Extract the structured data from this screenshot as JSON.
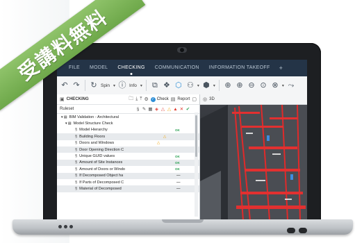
{
  "watermark": {
    "text": "受講料無料",
    "color": "#7cb557"
  },
  "menu": {
    "items": [
      "FILE",
      "MODEL",
      "CHECKING",
      "COMMUNICATION",
      "INFORMATION TAKEOFF"
    ],
    "active": "CHECKING",
    "plus": "+"
  },
  "toolbar": {
    "spin_label": "Spin",
    "info_label": "Info"
  },
  "checking_panel": {
    "title": "CHECKING",
    "check_label": "Check",
    "report_label": "Report",
    "column_label": "Ruleset",
    "rows": [
      {
        "label": "BIM Validation - Architectural",
        "status": "",
        "level": 0
      },
      {
        "label": "Model Structure Check",
        "status": "",
        "level": 1
      },
      {
        "label": "Model Hierarchy",
        "status": "ok",
        "level": 2
      },
      {
        "label": "Building Floors",
        "status": "warn",
        "level": 2
      },
      {
        "label": "Doors and Windows",
        "status": "warn",
        "level": 2
      },
      {
        "label": "Door Opening Direction C",
        "status": "",
        "level": 2
      },
      {
        "label": "Unique GUID values",
        "status": "ok",
        "level": 2
      },
      {
        "label": "Amount of Site Instances",
        "status": "ok",
        "level": 2
      },
      {
        "label": "Amount of Doors or Windo",
        "status": "ok",
        "level": 2
      },
      {
        "label": "If Decomposed Object ha",
        "status": "dash",
        "level": 2
      },
      {
        "label": "If Parts of Decomposed C",
        "status": "dash",
        "level": 2
      },
      {
        "label": "Material of Decomposed",
        "status": "dash",
        "level": 2
      }
    ],
    "ok_text": "OK",
    "dash_text": "—"
  },
  "view_panel": {
    "title": "3D"
  },
  "colors": {
    "menubar": "#243447",
    "ok": "#2aa052",
    "warning": "#f0a000",
    "error": "#e03a2f"
  }
}
